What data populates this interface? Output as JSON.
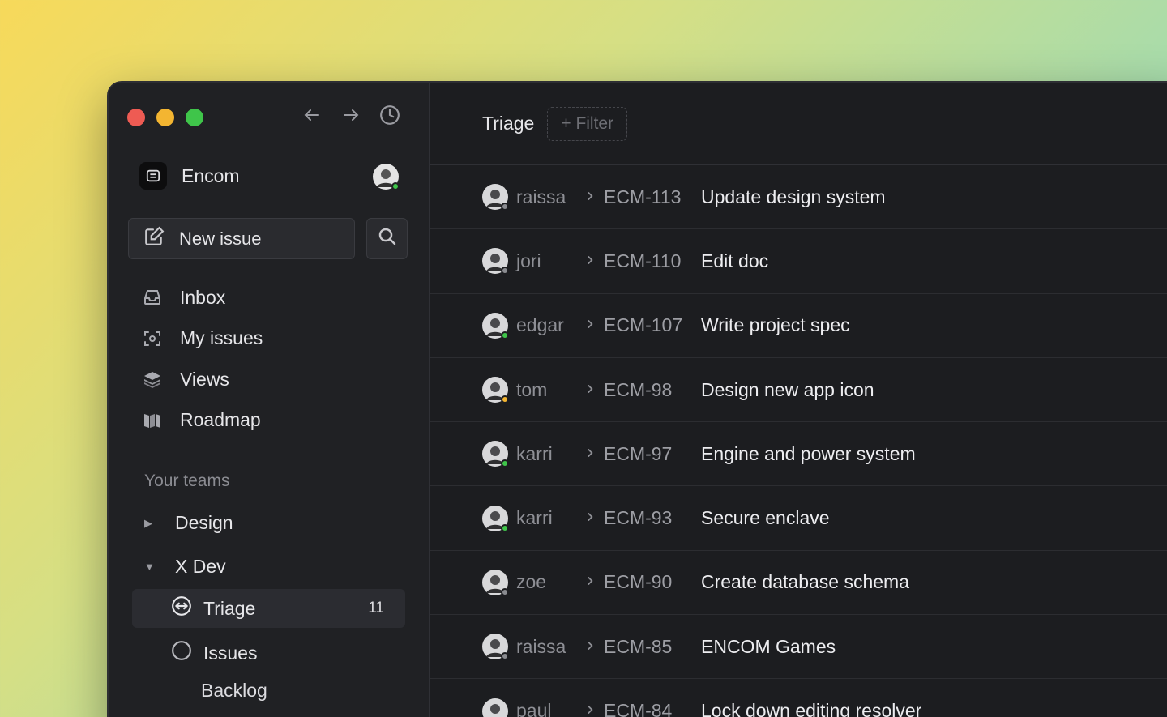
{
  "window": {
    "workspace_name": "Encom",
    "new_issue_label": "New issue",
    "nav": [
      {
        "label": "Inbox",
        "icon": "inbox-icon"
      },
      {
        "label": "My issues",
        "icon": "my-issues-icon"
      },
      {
        "label": "Views",
        "icon": "views-icon"
      },
      {
        "label": "Roadmap",
        "icon": "roadmap-icon"
      }
    ],
    "teams_label": "Your teams",
    "teams": [
      {
        "name": "Design",
        "expanded": false
      },
      {
        "name": "X Dev",
        "expanded": true
      }
    ],
    "team_items": {
      "triage_label": "Triage",
      "triage_count": "11",
      "issues_label": "Issues",
      "backlog_label": "Backlog"
    }
  },
  "main": {
    "title": "Triage",
    "filter_label": "+ Filter",
    "rows": [
      {
        "user": "raissa",
        "id": "ECM-113",
        "title": "Update design system",
        "status_color": "#8a8b90"
      },
      {
        "user": "jori",
        "id": "ECM-110",
        "title": "Edit doc",
        "status_color": "#8a8b90"
      },
      {
        "user": "edgar",
        "id": "ECM-107",
        "title": "Write project spec",
        "status_color": "#3fc54a"
      },
      {
        "user": "tom",
        "id": "ECM-98",
        "title": "Design new app icon",
        "status_color": "#f3b531"
      },
      {
        "user": "karri",
        "id": "ECM-97",
        "title": "Engine and power system",
        "status_color": "#3fc54a"
      },
      {
        "user": "karri",
        "id": "ECM-93",
        "title": "Secure enclave",
        "status_color": "#3fc54a"
      },
      {
        "user": "zoe",
        "id": "ECM-90",
        "title": "Create database schema",
        "status_color": "#8a8b90"
      },
      {
        "user": "raissa",
        "id": "ECM-85",
        "title": "ENCOM Games",
        "status_color": "#8a8b90"
      },
      {
        "user": "paul",
        "id": "ECM-84",
        "title": "Lock down editing resolver",
        "status_color": "#8a8b90"
      }
    ]
  }
}
